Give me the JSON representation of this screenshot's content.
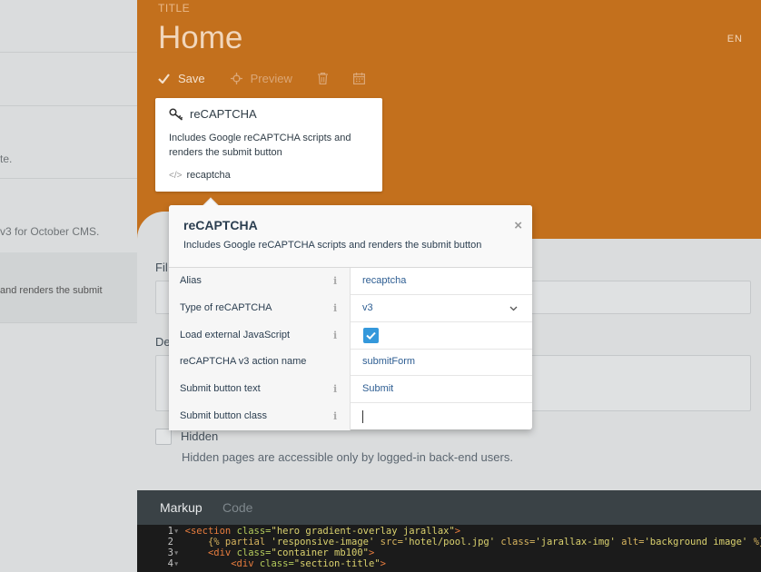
{
  "sidebar": {
    "texts": [
      "te.",
      "v3 for October CMS.",
      "and renders the submit"
    ]
  },
  "header": {
    "label": "TITLE",
    "title": "Home",
    "lang": "EN",
    "toolbar": {
      "save": "Save",
      "preview": "Preview"
    }
  },
  "card": {
    "title": "reCAPTCHA",
    "description": "Includes Google reCAPTCHA scripts and renders the submit button",
    "alias": "recaptcha"
  },
  "form": {
    "file_label": "Fil",
    "desc_label": "De",
    "hidden_label": "Hidden",
    "hidden_help": "Hidden pages are accessible only by logged-in back-end users."
  },
  "code_tabs": {
    "markup": "Markup",
    "code": "Code"
  },
  "popup": {
    "title": "reCAPTCHA",
    "description": "Includes Google reCAPTCHA scripts and renders the submit button",
    "close": "×",
    "properties": [
      {
        "name": "Alias",
        "value": "recaptcha"
      },
      {
        "name": "Type of reCAPTCHA",
        "value": "v3"
      },
      {
        "name": "Load external JavaScript",
        "value": ""
      },
      {
        "name": "reCAPTCHA v3 action name",
        "value": "submitForm"
      },
      {
        "name": "Submit button text",
        "value": "Submit"
      },
      {
        "name": "Submit button class",
        "value": ""
      }
    ],
    "load_js_checked": true
  },
  "editor": {
    "lines": [
      {
        "n": "1",
        "fold": true,
        "html": [
          [
            "tag",
            "<section "
          ],
          [
            "attr",
            "class="
          ],
          [
            "str",
            "\"hero gradient-overlay jarallax\""
          ],
          [
            "tag",
            ">"
          ]
        ]
      },
      {
        "n": "2",
        "fold": false,
        "html": [
          [
            "plain",
            "    "
          ],
          [
            "twig",
            "{% partial "
          ],
          [
            "str",
            "'responsive-image'"
          ],
          [
            "twig",
            " src="
          ],
          [
            "str",
            "'hotel/pool.jpg'"
          ],
          [
            "twig",
            " class="
          ],
          [
            "str",
            "'jarallax-img'"
          ],
          [
            "twig",
            " alt="
          ],
          [
            "str",
            "'background image'"
          ],
          [
            "twig",
            " %}"
          ]
        ]
      },
      {
        "n": "3",
        "fold": true,
        "html": [
          [
            "plain",
            "    "
          ],
          [
            "tag",
            "<div "
          ],
          [
            "attr",
            "class="
          ],
          [
            "str",
            "\"container mb100\""
          ],
          [
            "tag",
            ">"
          ]
        ]
      },
      {
        "n": "4",
        "fold": true,
        "html": [
          [
            "plain",
            "        "
          ],
          [
            "tag",
            "<div "
          ],
          [
            "attr",
            "class="
          ],
          [
            "str",
            "\"section-title\""
          ],
          [
            "tag",
            ">"
          ]
        ]
      }
    ]
  },
  "colors": {
    "header_bg": "#c3701d",
    "accent_blue": "#3498db"
  }
}
